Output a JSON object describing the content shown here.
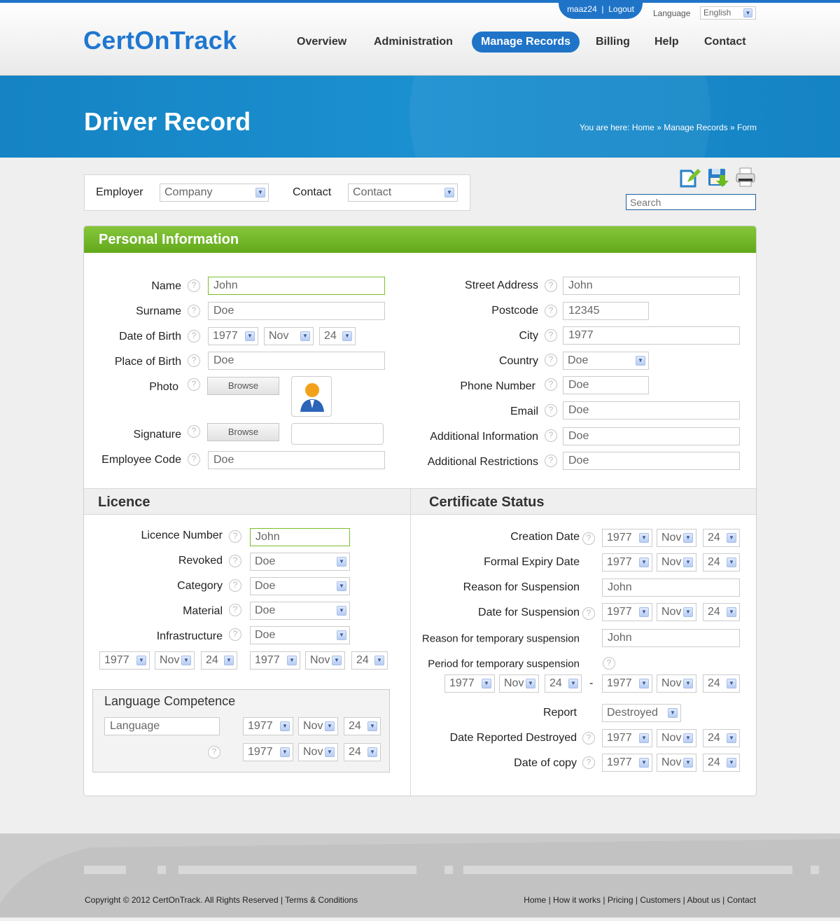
{
  "header": {
    "user": "maaz24",
    "logout": "Logout",
    "language_label": "Language",
    "language_value": "English",
    "logo": "CertOnTrack",
    "nav": [
      "Overview",
      "Administration",
      "Manage Records",
      "Billing",
      "Help",
      "Contact"
    ],
    "active_nav": "Manage Records"
  },
  "banner": {
    "title": "Driver Record",
    "breadcrumb_prefix": "You are here:",
    "breadcrumb": [
      "Home",
      "Manage Records",
      "Form"
    ],
    "separator": "»"
  },
  "filter": {
    "employer_label": "Employer",
    "employer_value": "Company",
    "contact_label": "Contact",
    "contact_value": "Contact"
  },
  "toolbar": {
    "icons": [
      "edit-icon",
      "save-icon",
      "print-icon"
    ],
    "search_placeholder": "Search"
  },
  "personal": {
    "title": "Personal Information",
    "name": {
      "label": "Name",
      "value": "John"
    },
    "surname": {
      "label": "Surname",
      "value": "Doe"
    },
    "dob": {
      "label": "Date of Birth",
      "year": "1977",
      "month": "Nov",
      "day": "24"
    },
    "pob": {
      "label": "Place of Birth",
      "value": "Doe"
    },
    "photo": {
      "label": "Photo",
      "button": "Browse"
    },
    "signature": {
      "label": "Signature",
      "button": "Browse"
    },
    "employee_code": {
      "label": "Employee Code",
      "value": "Doe"
    },
    "street": {
      "label": "Street Address",
      "value": "John"
    },
    "postcode": {
      "label": "Postcode",
      "value": "12345"
    },
    "city": {
      "label": "City",
      "value": "1977"
    },
    "country": {
      "label": "Country",
      "value": "Doe"
    },
    "phone": {
      "label": "Phone Number",
      "value": "Doe"
    },
    "email": {
      "label": "Email",
      "value": "Doe"
    },
    "additional_info": {
      "label": "Additional Information",
      "value": "Doe"
    },
    "additional_restrictions": {
      "label": "Additional Restrictions",
      "value": "Doe"
    }
  },
  "licence": {
    "title": "Licence",
    "number": {
      "label": "Licence Number",
      "value": "John"
    },
    "revoked": {
      "label": "Revoked",
      "value": "Doe"
    },
    "category": {
      "label": "Category",
      "value": "Doe"
    },
    "material": {
      "label": "Material",
      "value": "Doe"
    },
    "infrastructure": {
      "label": "Infrastructure",
      "value": "Doe"
    },
    "date_from": {
      "year": "1977",
      "month": "Nov",
      "day": "24"
    },
    "date_to": {
      "year": "1977",
      "month": "Nov",
      "day": "24"
    },
    "language": {
      "title": "Language Competence",
      "placeholder": "Language",
      "date1": {
        "year": "1977",
        "month": "Nov",
        "day": "24"
      },
      "date2": {
        "year": "1977",
        "month": "Nov",
        "day": "24"
      }
    }
  },
  "certificate": {
    "title": "Certificate Status",
    "creation": {
      "label": "Creation Date",
      "year": "1977",
      "month": "Nov",
      "day": "24"
    },
    "expiry": {
      "label": "Formal Expiry Date",
      "year": "1977",
      "month": "Nov",
      "day": "24"
    },
    "reason_suspension": {
      "label": "Reason for Suspension",
      "value": "John"
    },
    "date_suspension": {
      "label": "Date for Suspension",
      "year": "1977",
      "month": "Nov",
      "day": "24"
    },
    "reason_temp": {
      "label": "Reason for temporary suspension",
      "value": "John"
    },
    "period_temp": {
      "label": "Period for temporary suspension",
      "dash": "-",
      "from": {
        "year": "1977",
        "month": "Nov",
        "day": "24"
      },
      "to": {
        "year": "1977",
        "month": "Nov",
        "day": "24"
      }
    },
    "report": {
      "label": "Report",
      "value": "Destroyed"
    },
    "date_destroyed": {
      "label": "Date Reported Destroyed",
      "year": "1977",
      "month": "Nov",
      "day": "24"
    },
    "date_copy": {
      "label": "Date of copy",
      "year": "1977",
      "month": "Nov",
      "day": "24"
    }
  },
  "footer": {
    "copyright": "Copyright © 2012 CertOnTrack. All Rights Reserved",
    "terms": "Terms & Conditions",
    "links": [
      "Home",
      "How it works",
      "Pricing",
      "Customers",
      "About us",
      "Contact"
    ]
  },
  "colors": {
    "brand": "#1f74c8",
    "section_green": "#6fb42a"
  }
}
